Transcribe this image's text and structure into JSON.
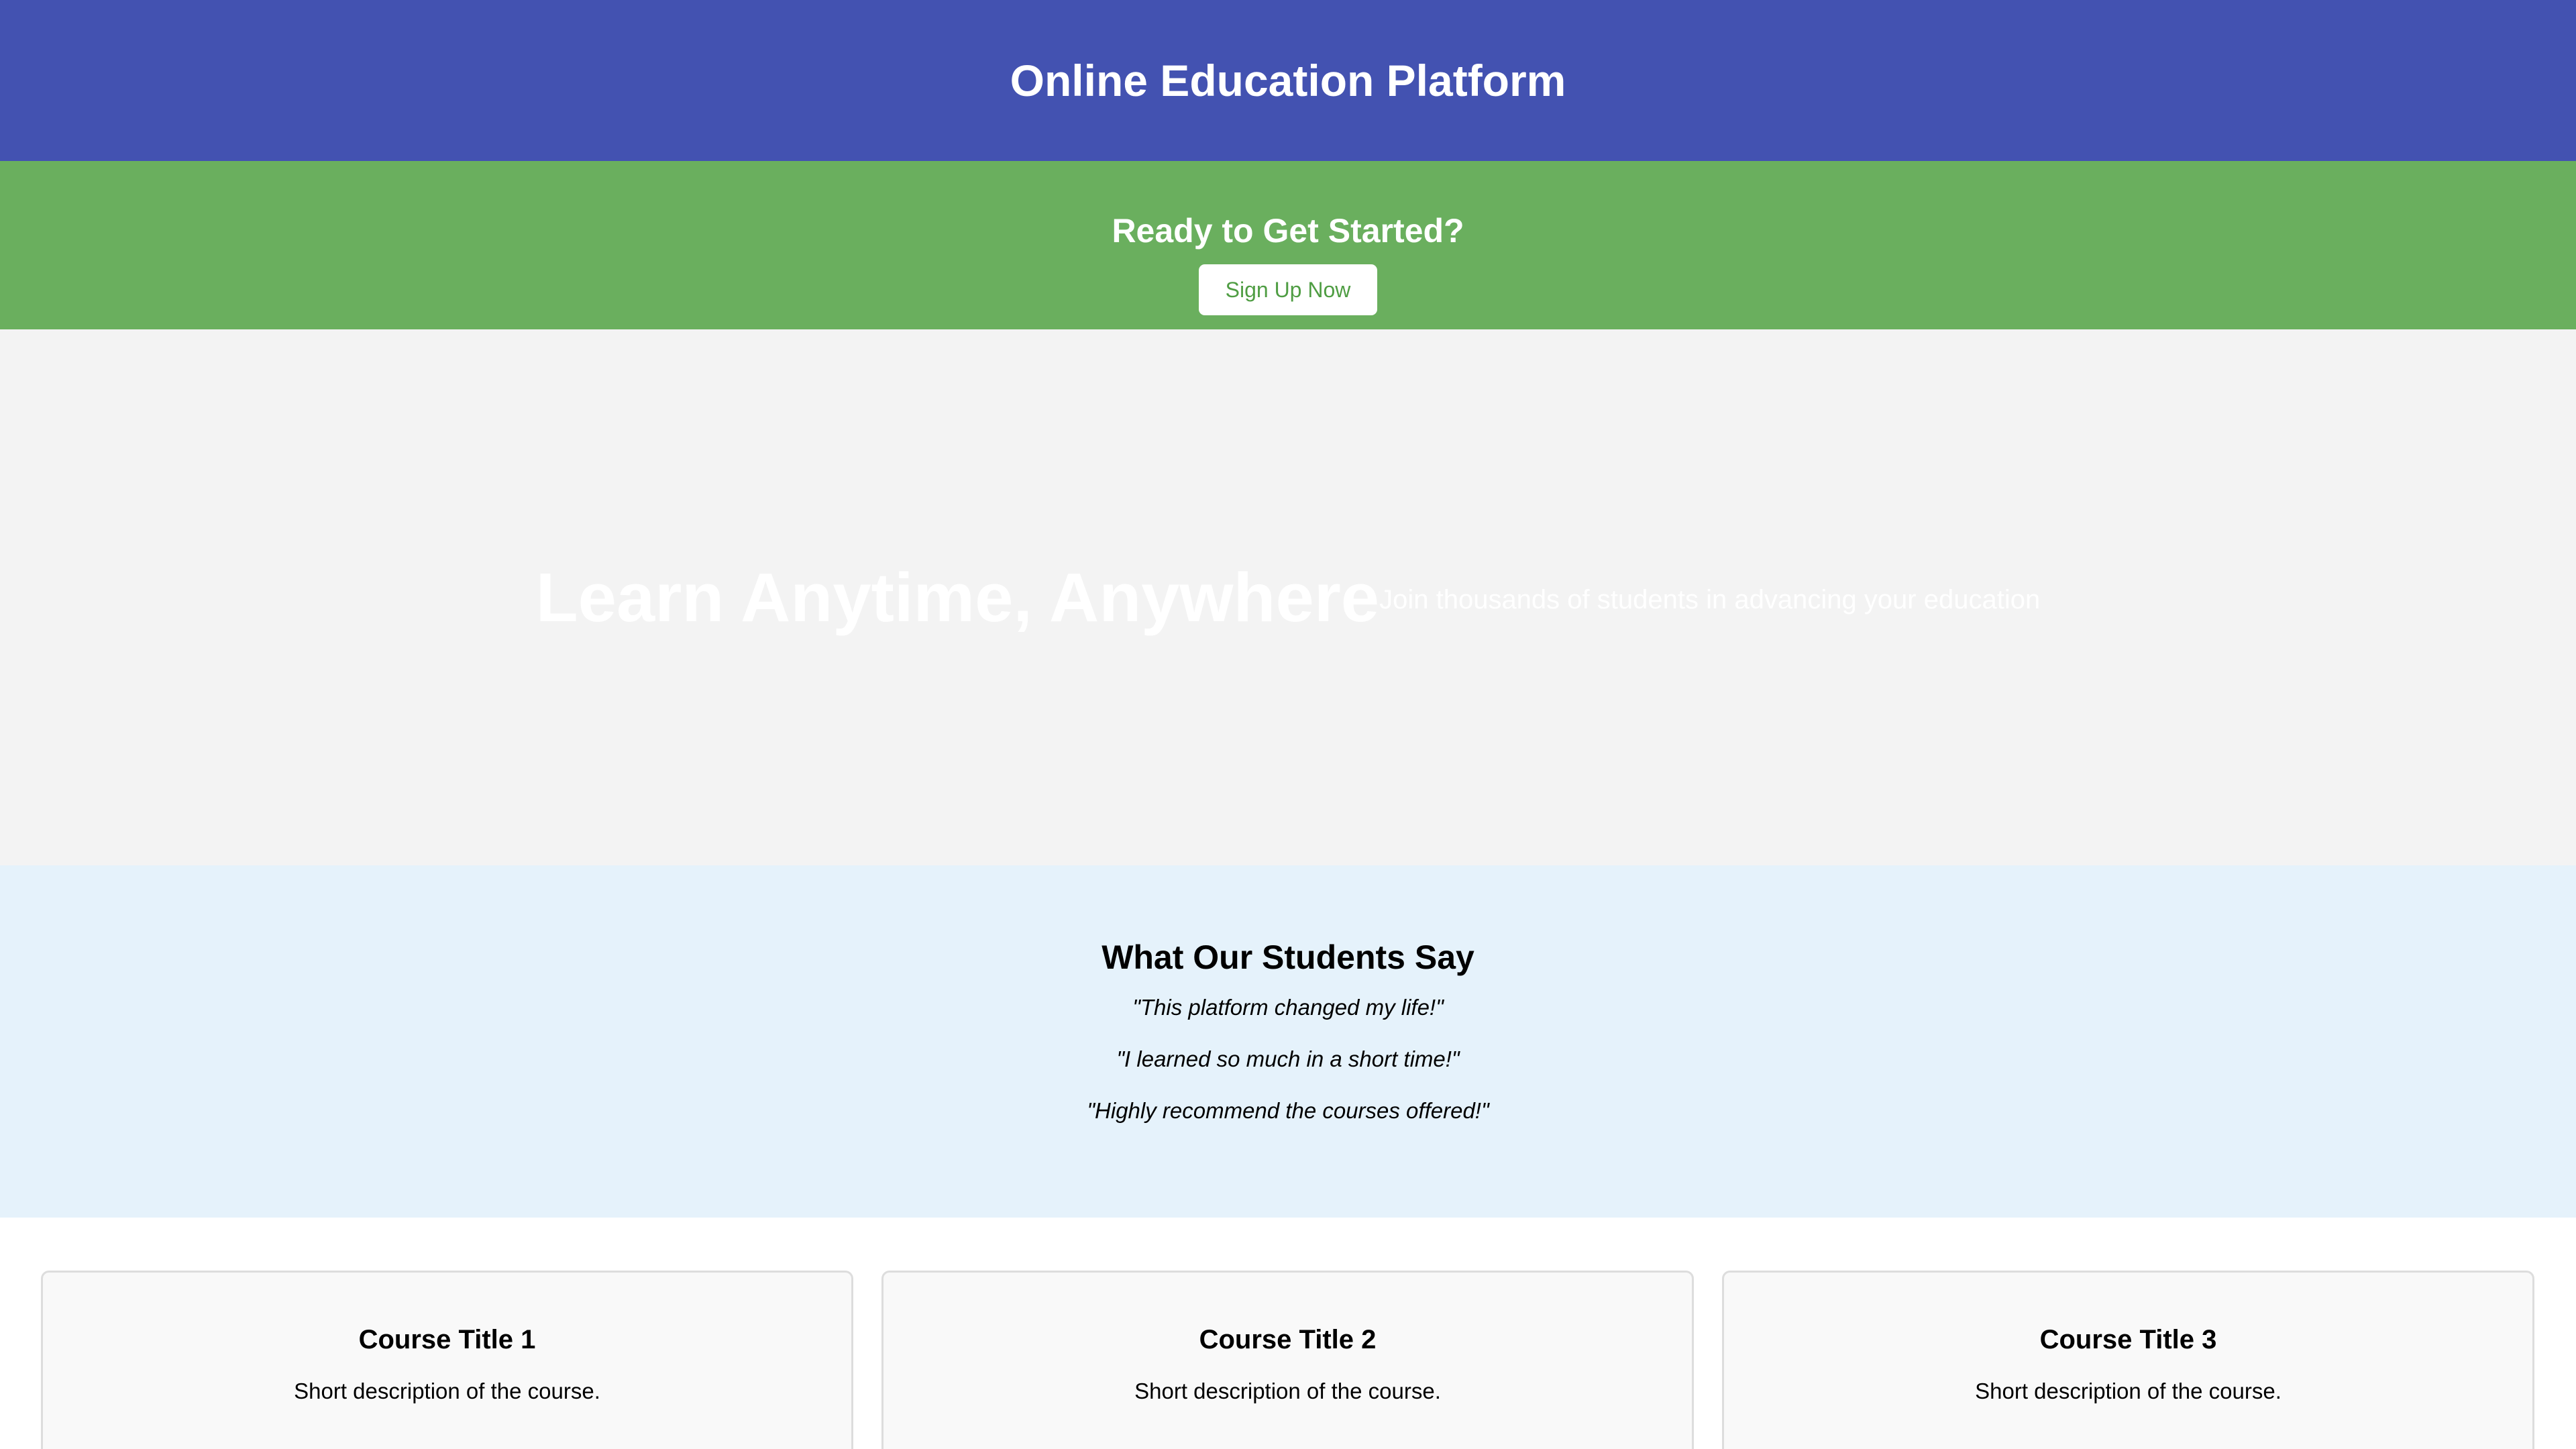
{
  "header": {
    "title": "Online Education Platform"
  },
  "cta": {
    "title": "Ready to Get Started?",
    "button_label": "Sign Up Now"
  },
  "hero": {
    "title": "Learn Anytime, Anywhere",
    "subtitle": "Join thousands of students in advancing your education"
  },
  "testimonials": {
    "title": "What Our Students Say",
    "quotes": [
      "\"This platform changed my life!\"",
      "\"I learned so much in a short time!\"",
      "\"Highly recommend the courses offered!\""
    ]
  },
  "courses": [
    {
      "title": "Course Title 1",
      "description": "Short description of the course."
    },
    {
      "title": "Course Title 2",
      "description": "Short description of the course."
    },
    {
      "title": "Course Title 3",
      "description": "Short description of the course."
    }
  ],
  "colors": {
    "header_bg": "#4352b1",
    "cta_bg": "#6aaf5e",
    "cta_button_text": "#4f9d43",
    "hero_bg": "#f3f3f3",
    "testimonials_bg": "#e5f2fb",
    "card_bg": "#f9f9f9",
    "card_border": "#dddddd"
  }
}
